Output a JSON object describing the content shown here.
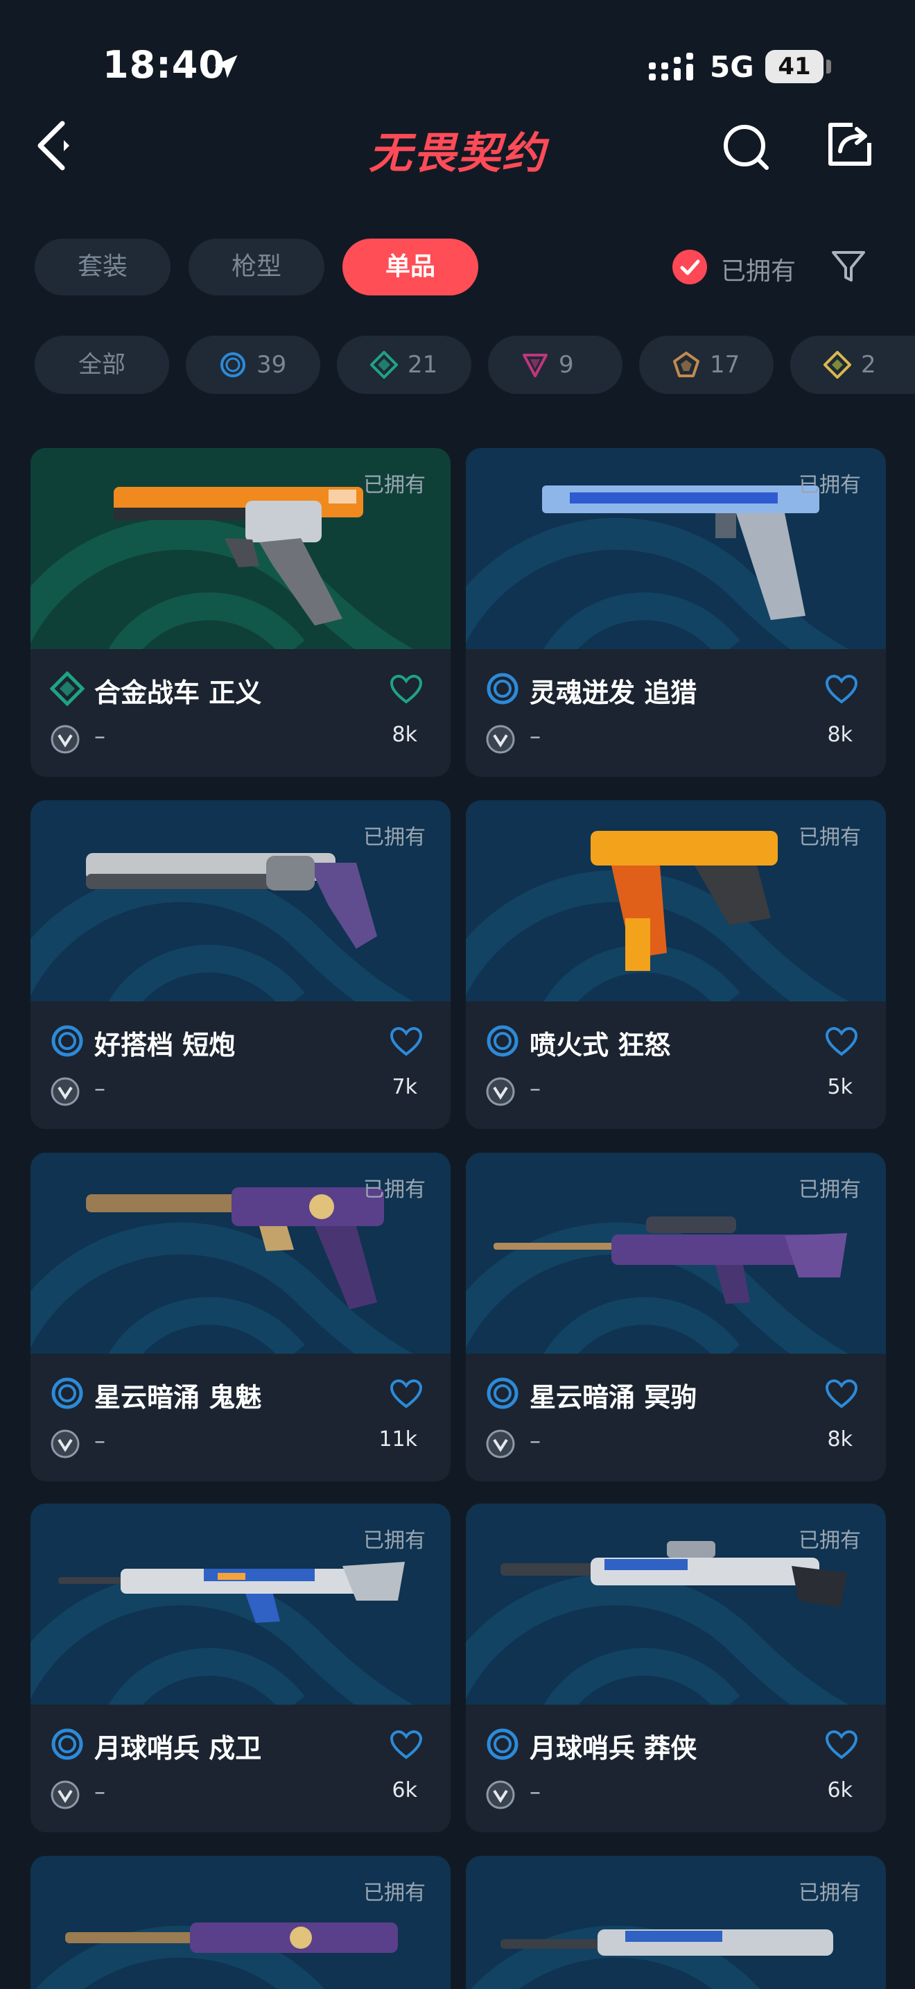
{
  "status": {
    "time": "18:40",
    "network": "5G",
    "battery": "41"
  },
  "header": {
    "title": "无畏契约"
  },
  "tabs": [
    {
      "label": "套装",
      "active": false
    },
    {
      "label": "枪型",
      "active": false
    },
    {
      "label": "单品",
      "active": true
    }
  ],
  "owned_filter": {
    "label": "已拥有",
    "checked": true
  },
  "chips": [
    {
      "label": "全部"
    },
    {
      "icon": "select-tier-icon",
      "count": "39",
      "color": "#2d8ad8"
    },
    {
      "icon": "deluxe-tier-icon",
      "count": "21",
      "color": "#1fa384"
    },
    {
      "icon": "premium-tier-icon",
      "count": "9",
      "color": "#c0367a"
    },
    {
      "icon": "exclusive-tier-icon",
      "count": "17",
      "color": "#c28a4e"
    },
    {
      "icon": "ultra-tier-icon",
      "count": "2",
      "color": "#d9b84e"
    }
  ],
  "cards": [
    {
      "name": "合金战车 正义",
      "owned": "已拥有",
      "price": "–",
      "likes": "8k",
      "tier": "deluxe",
      "bg": "green"
    },
    {
      "name": "灵魂迸发 追猎",
      "owned": "已拥有",
      "price": "–",
      "likes": "8k",
      "tier": "select",
      "bg": "blue"
    },
    {
      "name": "好搭档 短炮",
      "owned": "已拥有",
      "price": "–",
      "likes": "7k",
      "tier": "select",
      "bg": "blue"
    },
    {
      "name": "喷火式 狂怒",
      "owned": "已拥有",
      "price": "–",
      "likes": "5k",
      "tier": "select",
      "bg": "blue"
    },
    {
      "name": "星云暗涌 鬼魅",
      "owned": "已拥有",
      "price": "–",
      "likes": "11k",
      "tier": "select",
      "bg": "blue"
    },
    {
      "name": "星云暗涌 冥驹",
      "owned": "已拥有",
      "price": "–",
      "likes": "8k",
      "tier": "select",
      "bg": "blue"
    },
    {
      "name": "月球哨兵 戍卫",
      "owned": "已拥有",
      "price": "–",
      "likes": "6k",
      "tier": "select",
      "bg": "blue"
    },
    {
      "name": "月球哨兵 莽侠",
      "owned": "已拥有",
      "price": "–",
      "likes": "6k",
      "tier": "select",
      "bg": "blue"
    },
    {
      "owned": "已拥有"
    },
    {
      "owned": "已拥有"
    }
  ],
  "colors": {
    "accent": "#ff4e55",
    "background": "#111a24",
    "card": "#1b2430",
    "select_tier": "#2d8ad8",
    "deluxe_tier": "#1fa384"
  }
}
